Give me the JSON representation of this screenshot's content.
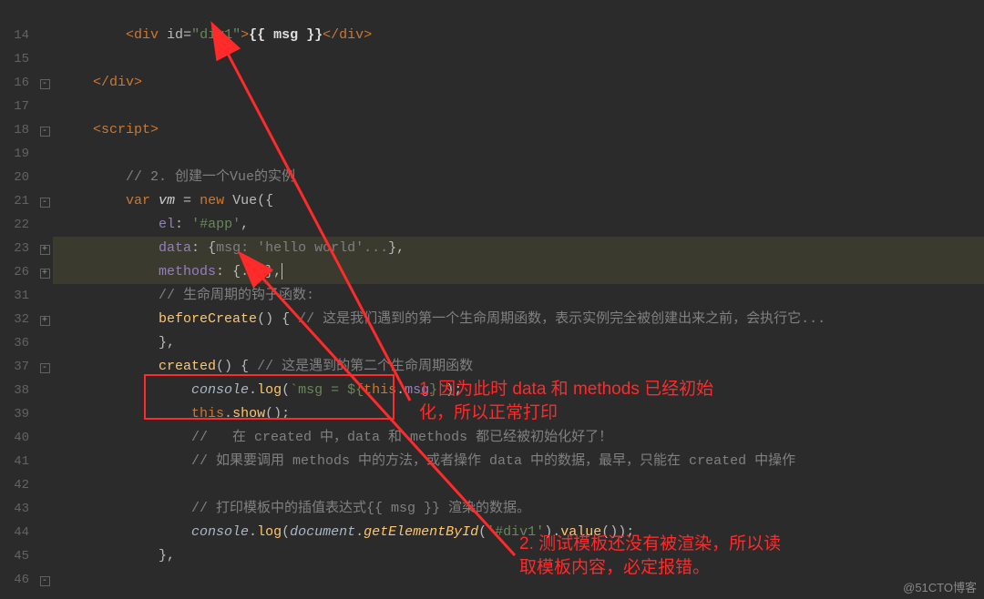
{
  "gutter": [
    "",
    "14",
    "15",
    "16",
    "17",
    "18",
    "19",
    "20",
    "21",
    "22",
    "23",
    "26",
    "31",
    "32",
    "36",
    "37",
    "38",
    "39",
    "40",
    "41",
    "42",
    "43",
    "44",
    "45",
    "46"
  ],
  "fold": [
    "",
    "",
    "",
    "-",
    "",
    "-",
    "",
    "",
    "-",
    "",
    "+",
    "+",
    "",
    "+",
    "",
    "-",
    "",
    "",
    "",
    "",
    "",
    "",
    "",
    "",
    "-"
  ],
  "code": {
    "l14": {
      "open": "<",
      "tag": "div ",
      "attr": "id",
      "eq": "=",
      "q1": "\"",
      "val": "div1",
      "q2": "\"",
      "close": ">",
      "mustache": "{{ msg }}",
      "end": "</",
      "tag2": "div",
      "end2": ">"
    },
    "l16": {
      "end": "</",
      "tag": "div",
      "close": ">"
    },
    "l18": {
      "open": "<",
      "tag": "script",
      "close": ">"
    },
    "l20": "// 2. 创建一个Vue的实例",
    "l21": {
      "var": "var ",
      "vm": "vm",
      " = ": " = ",
      "new": "new ",
      "Vue": "Vue",
      "p": "({"
    },
    "l22": {
      "prop": "el",
      "colon": ": ",
      "str": "'#app'",
      "comma": ","
    },
    "l23": {
      "prop": "data",
      "colon": ": ",
      "open": "{",
      "body": "msg: 'hello world'...",
      "close": ","
    },
    "l26": {
      "prop": "methods",
      "colon": ": ",
      "body": "{...}",
      "comma": ","
    },
    "l31": "// 生命周期的钩子函数:",
    "l32": {
      "fn": "beforeCreate",
      "paren": "() { ",
      "c": "// 这是我们遇到的第一个生命周期函数，表示实例完全被创建出来之前，会执行它..."
    },
    "l36": "},",
    "l37": {
      "fn": "created",
      "paren": "() { ",
      "c": "// 这是遇到的第二个生命周期函数"
    },
    "l38": {
      "obj": "console",
      "dot": ".",
      "m": "log",
      "open": "(",
      "tick": "`",
      "body": "msg = ",
      "dollar": "${",
      "this": "this",
      "dot2": ".",
      "prop": "msg",
      "close": "}",
      "tick2": "`",
      "close2": ");"
    },
    "l39": {
      "this": "this",
      "dot": ".",
      "m": "show",
      "paren": "();"
    },
    "l40": "//   在 created 中，data 和 methods 都已经被初始化好了！",
    "l41": "// 如果要调用 methods 中的方法，或者操作 data 中的数据，最早，只能在 created 中操作",
    "l43": "// 打印模板中的插值表达式{{ msg }} 渲染的数据。",
    "l44": {
      "obj": "console",
      "dot": ".",
      "m": "log",
      "open": "(",
      "doc": "document",
      "dot2": ".",
      "gm": "getElementById",
      "open2": "(",
      "str": "'#div1'",
      "close2": ").",
      "val": "value",
      "paren": "());"
    },
    "l45": "},"
  },
  "annotations": {
    "a1_line1": "1. 因为此时 data 和 methods 已经初始",
    "a1_line2": "化，所以正常打印",
    "a2_line1": "2. 测试模板还没有被渲染，所以读",
    "a2_line2": "取模板内容，必定报错。"
  },
  "watermark": "@51CTO博客"
}
